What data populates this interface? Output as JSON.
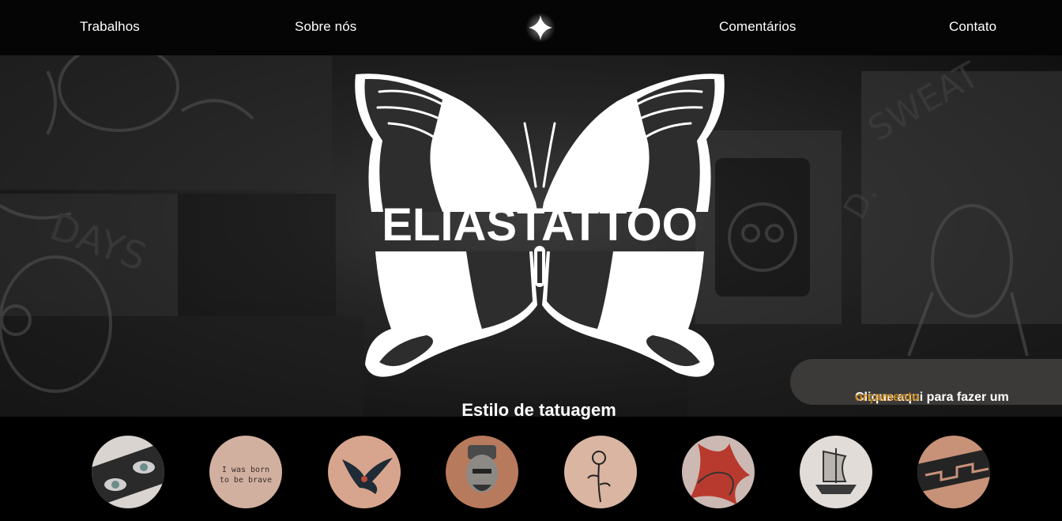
{
  "nav": {
    "items": [
      {
        "label": "Trabalhos"
      },
      {
        "label": "Sobre nós"
      },
      {
        "label": "Comentários"
      },
      {
        "label": "Contato"
      }
    ],
    "center_icon": "sparkle-star-icon"
  },
  "hero": {
    "brand": "ELIASTATTOO",
    "logo_icon": "butterfly-logo"
  },
  "quote_button": {
    "prefix": "Clique aqui para fazer um",
    "accent": "orçamento",
    "accent_color": "#c8891f"
  },
  "styles": {
    "title": "Estilo de tatuagem",
    "items": [
      {
        "icon": "realism-eyes-tattoo-thumbnail"
      },
      {
        "icon": "lettering-tattoo-thumbnail",
        "text_line1": "I was born",
        "text_line2": "to be brave"
      },
      {
        "icon": "swallow-tattoo-thumbnail"
      },
      {
        "icon": "portrait-tattoo-thumbnail"
      },
      {
        "icon": "rose-tattoo-thumbnail"
      },
      {
        "icon": "red-dragon-tattoo-thumbnail"
      },
      {
        "icon": "ship-tattoo-thumbnail"
      },
      {
        "icon": "tribal-band-tattoo-thumbnail"
      }
    ]
  }
}
